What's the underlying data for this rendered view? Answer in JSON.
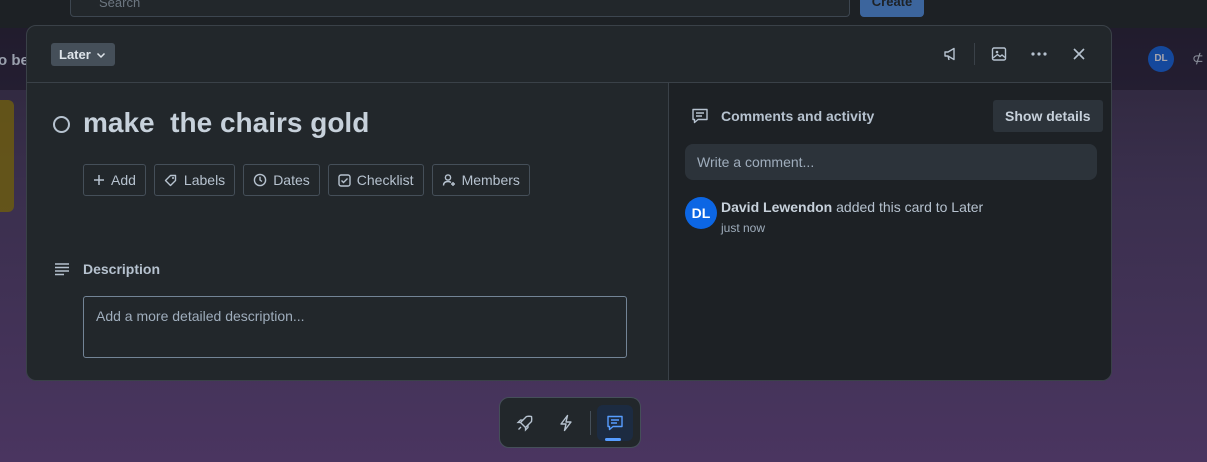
{
  "background": {
    "search_placeholder": "Search",
    "create_label": "Create",
    "board_name_fragment": "o be",
    "avatar_initials": "DL",
    "right_fragment": "⊄"
  },
  "modal": {
    "list_badge": "Later",
    "title": "make  the chairs gold",
    "actions": [
      {
        "label": "Add",
        "icon": "plus-icon"
      },
      {
        "label": "Labels",
        "icon": "tag-icon"
      },
      {
        "label": "Dates",
        "icon": "clock-icon"
      },
      {
        "label": "Checklist",
        "icon": "checkbox-icon"
      },
      {
        "label": "Members",
        "icon": "add-person-icon"
      }
    ],
    "description": {
      "label": "Description",
      "placeholder": "Add a more detailed description..."
    },
    "activity": {
      "title": "Comments and activity",
      "show_details_label": "Show details",
      "comment_placeholder": "Write a comment...",
      "entries": [
        {
          "initials": "DL",
          "user": "David Lewendon",
          "text": " added this card to Later",
          "time": "just now"
        }
      ]
    }
  },
  "colors": {
    "accent": "#579dff",
    "modal_bg": "#22272b",
    "activity_bg": "#1d2125",
    "avatar_bg": "#0c66e4"
  }
}
